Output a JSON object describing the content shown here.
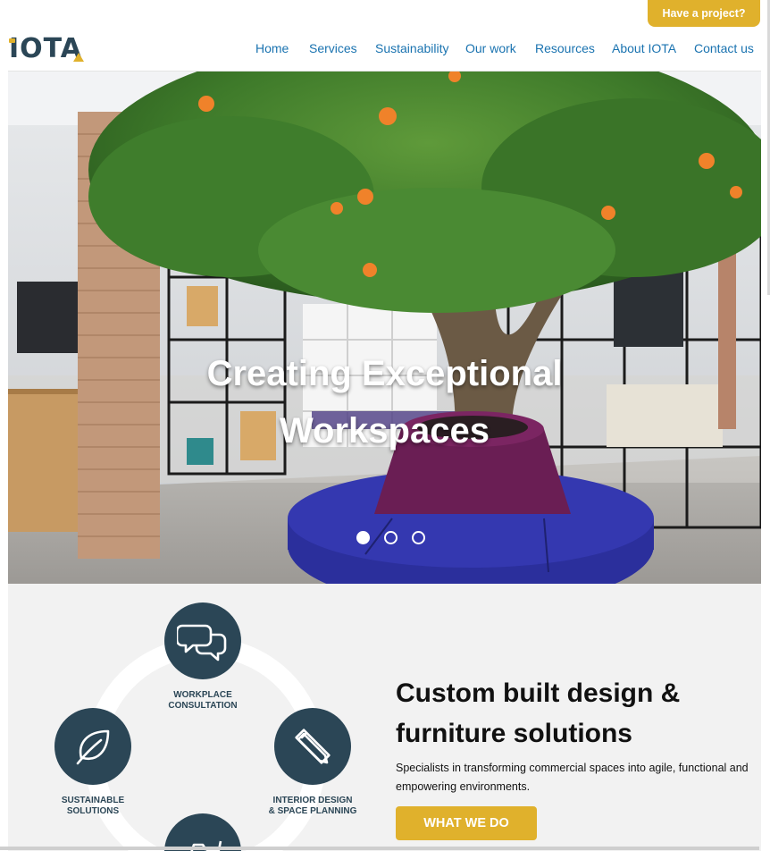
{
  "header": {
    "cta_label": "Have a project?",
    "logo_text": "IOTA",
    "nav": [
      {
        "label": "Home"
      },
      {
        "label": "Services"
      },
      {
        "label": "Sustainability"
      },
      {
        "label": "Our work"
      },
      {
        "label": "Resources"
      },
      {
        "label": "About IOTA"
      },
      {
        "label": "Contact us"
      }
    ]
  },
  "hero": {
    "title_line1": "Creating Exceptional",
    "title_line2": "Workspaces",
    "slides_total": 3,
    "active_slide": 1
  },
  "services": [
    {
      "line1": "WORKPLACE",
      "line2": "CONSULTATION",
      "icon": "chat-bubbles-icon"
    },
    {
      "line1": "SUSTAINABLE",
      "line2": "SOLUTIONS",
      "icon": "leaf-icon"
    },
    {
      "line1": "INTERIOR DESIGN",
      "line2": "& SPACE PLANNING",
      "icon": "ruler-pencil-icon"
    },
    {
      "icon": "furniture-icon"
    }
  ],
  "intro": {
    "heading_line1": "Custom built design &",
    "heading_line2": "furniture solutions",
    "body": "Specialists in transforming commercial spaces into agile, functional and empowering environments.",
    "button_label": "WHAT WE DO"
  },
  "colors": {
    "accent": "#e0b12c",
    "brand_dark": "#2b4656",
    "link": "#1a73b0",
    "section_bg": "#f2f2f2"
  }
}
